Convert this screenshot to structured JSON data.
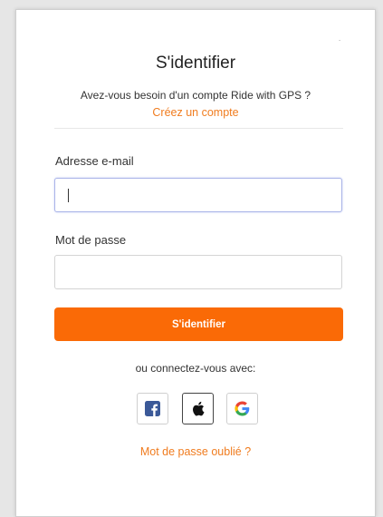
{
  "dialog": {
    "title": "S'identifier",
    "close_glyph": "˙",
    "subtitle": "Avez-vous besoin d'un compte Ride with GPS ?",
    "signup_link": "Créez un compte"
  },
  "form": {
    "email_label": "Adresse e-mail",
    "email_value": "",
    "email_placeholder": "",
    "password_label": "Mot de passe",
    "password_value": "",
    "password_placeholder": "",
    "submit_label": "S'identifier"
  },
  "social": {
    "prompt": "ou connectez-vous avec:",
    "providers": [
      {
        "name": "facebook",
        "icon": "facebook-icon",
        "color": "#3b5998"
      },
      {
        "name": "apple",
        "icon": "apple-icon",
        "color": "#111111"
      },
      {
        "name": "google",
        "icon": "google-icon",
        "color": "#4285f4"
      }
    ]
  },
  "forgot_password": "Mot de passe oublié ?",
  "colors": {
    "accent": "#fa6a06",
    "link": "#f07c1f",
    "focus_border": "#aab4e8"
  }
}
